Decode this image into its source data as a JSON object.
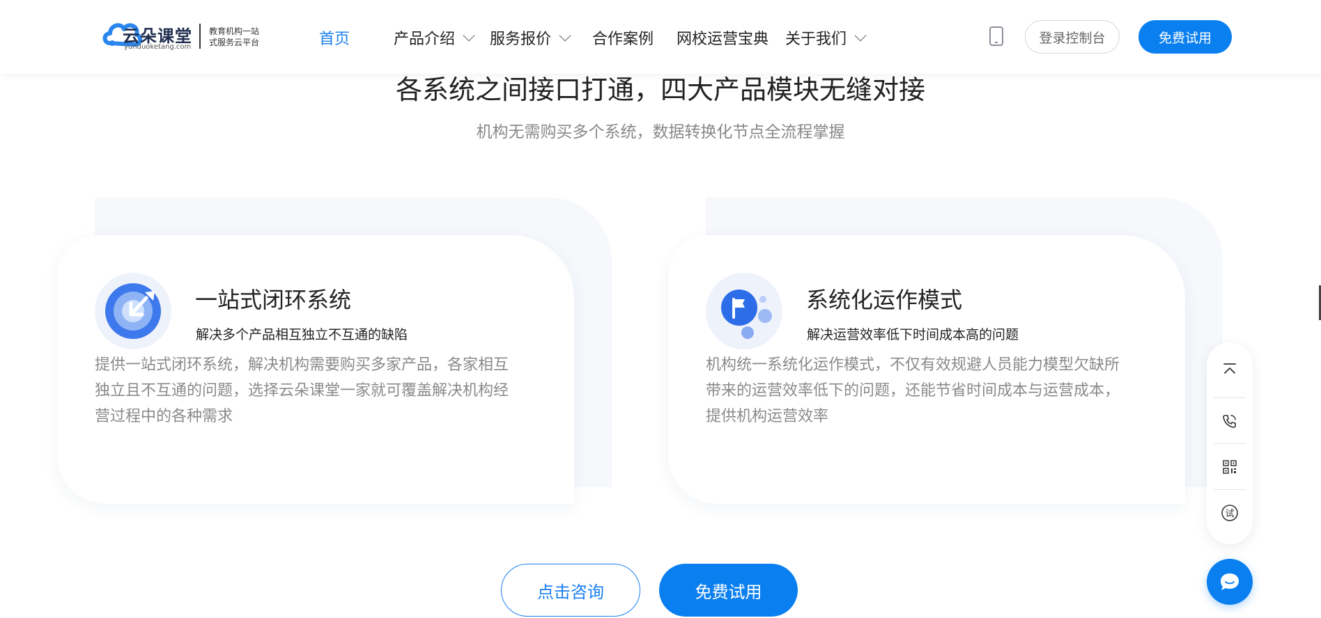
{
  "header": {
    "logo": {
      "name": "云朵课堂",
      "domain": "yunduoketang.com",
      "slogan_line1": "教育机构一站",
      "slogan_line2": "式服务云平台"
    },
    "nav": [
      {
        "label": "首页",
        "active": true
      },
      {
        "label": "产品介绍",
        "dropdown": true
      },
      {
        "label": "服务报价",
        "dropdown": true
      },
      {
        "label": "合作案例"
      },
      {
        "label": "网校运营宝典"
      },
      {
        "label": "关于我们",
        "dropdown": true
      }
    ],
    "phone_icon": "mobile-phone-icon",
    "login_label": "登录控制台",
    "trial_label": "免费试用"
  },
  "section": {
    "title": "各系统之间接口打通，四大产品模块无缝对接",
    "subtitle": "机构无需购买多个系统，数据转换化节点全流程掌握"
  },
  "cards": [
    {
      "icon": "closed-loop-icon",
      "title": "一站式闭环系统",
      "subtitle": "解决多个产品相互独立不互通的缺陷",
      "desc_lines": [
        "提供一站式闭环系统，解决机构需要购买多家产品，各家相互",
        "独立且不互通的问题，选择云朵课堂一家就可覆盖解决机构经",
        "营过程中的各种需求"
      ]
    },
    {
      "icon": "flag-icon",
      "title": "系统化运作模式",
      "subtitle": "解决运营效率低下时间成本高的问题",
      "desc_lines": [
        "机构统一系统化运作模式，不仅有效规避人员能力模型欠缺所",
        "带来的运营效率低下的问题，还能节省时间成本与运营成本，",
        "提供机构运营效率"
      ]
    }
  ],
  "cta": {
    "consult_label": "点击咨询",
    "trial_label": "免费试用"
  },
  "side_toolbar": {
    "items": [
      "back-to-top-icon",
      "phone-call-icon",
      "qrcode-icon",
      "trial-icon"
    ],
    "trial_glyph": "试"
  },
  "chat_icon": "chat-bubble-icon",
  "colors": {
    "brand_blue": "#0a7ff0",
    "text_dark": "#222222",
    "text_gray": "#888888"
  }
}
